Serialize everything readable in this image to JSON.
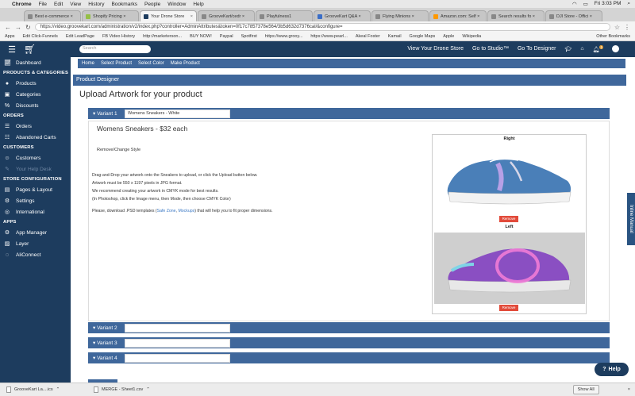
{
  "mac_menu": {
    "apple": "",
    "items": [
      "Chrome",
      "File",
      "Edit",
      "View",
      "History",
      "Bookmarks",
      "People",
      "Window",
      "Help"
    ],
    "clock": "Fri 3:03 PM"
  },
  "browser": {
    "tabs": [
      {
        "label": "Best e-commerce ×"
      },
      {
        "label": "Shopify Pricing ×"
      },
      {
        "label": "Your Drone Store"
      },
      {
        "label": "GrooveKart/cedr ×"
      },
      {
        "label": "Playfulness1"
      },
      {
        "label": "GrooveKart Q&A ×"
      },
      {
        "label": "Flying Minions ×"
      },
      {
        "label": "Amazon.com: Self ×"
      },
      {
        "label": "Search results fo ×"
      },
      {
        "label": "DJI Store - Offici ×"
      }
    ],
    "url": "https://video.groovekart.com/administration/v2/index.php?controller=AdminAttributes&token=0f17c7857378e564/3b5d632d7376cal/&configure=",
    "bookmarks": [
      "Apps",
      "Edit Click-Funnels",
      "Edit LeadPage",
      "FB Video History",
      "http://marketerson...",
      "BUY NOW!",
      "Paypal",
      "Spotfirst",
      "https://www.grooy...",
      "https://www.pearl...",
      "Akeal Foster",
      "Kamail",
      "Google Maps",
      "Apple",
      "Wikipedia",
      "Other Bookmarks"
    ]
  },
  "topnav": {
    "search_placeholder": "Search",
    "links": [
      "View Your Drone Store",
      "Go to Studio™",
      "Go To Designer"
    ],
    "notification_count": "1"
  },
  "sidebar": {
    "dashboard": "Dashboard",
    "sections": [
      {
        "heading": "PRODUCTS & CATEGORIES",
        "items": [
          {
            "label": "Products",
            "icon": "●"
          },
          {
            "label": "Categories",
            "icon": "▣"
          },
          {
            "label": "Discounts",
            "icon": "%"
          }
        ]
      },
      {
        "heading": "ORDERS",
        "items": [
          {
            "label": "Orders",
            "icon": "☰"
          },
          {
            "label": "Abandoned Carts",
            "icon": "☷"
          }
        ]
      },
      {
        "heading": "CUSTOMERS",
        "items": [
          {
            "label": "Customers",
            "icon": "☺"
          },
          {
            "label": "Your Help Desk",
            "icon": "✎"
          }
        ]
      },
      {
        "heading": "STORE CONFIGURATION",
        "items": [
          {
            "label": "Pages & Layout",
            "icon": "▤"
          },
          {
            "label": "Settings",
            "icon": "⚙"
          },
          {
            "label": "International",
            "icon": "◎"
          }
        ]
      },
      {
        "heading": "APPS",
        "items": [
          {
            "label": "App Manager",
            "icon": "⚙"
          },
          {
            "label": "Layer",
            "icon": "▨"
          },
          {
            "label": "AliConnect",
            "icon": "◌"
          }
        ]
      }
    ]
  },
  "breadcrumb": [
    "Home",
    "Select Product",
    "Select Color",
    "Make Product"
  ],
  "product_designer_label": "Product Designer",
  "page_title": "Upload Artwork for your product",
  "variants": [
    {
      "label": "▾ Variant 1",
      "value": "Womens Sneakers - White"
    },
    {
      "label": "▾ Variant 2",
      "value": ""
    },
    {
      "label": "▾ Variant 3",
      "value": ""
    },
    {
      "label": "▾ Variant 4",
      "value": ""
    }
  ],
  "variant1": {
    "product_name": "Womens Sneakers - $32 each",
    "remove_style": "Remove/Change Style",
    "instructions": [
      "Drag-and-Drop your artwork onto the Sneakers to upload, or click the Upload button below.",
      "Artwork must be 550 x 1197 pixels in JPG format.",
      "We recommend creating your artwork in CMYK mode for best results.",
      "(In Photoshop, click the Image menu, then Mode, then choose CMYK Color)"
    ],
    "psd_prefix": "Please, download .PSD templates (",
    "psd_link1": "Safe Zone",
    "psd_sep": ", ",
    "psd_link2": "Mockups",
    "psd_suffix": ") that will help you to fit proper dimensions.",
    "views": [
      {
        "label": "Right",
        "remove": "Remove"
      },
      {
        "label": "Left",
        "remove": "Remove"
      }
    ]
  },
  "inline_manual": "Inline Manual",
  "help": "Help",
  "downloads": [
    {
      "name": "GrooveKart La....ics"
    },
    {
      "name": "MERGE - Sheet1.csv"
    }
  ],
  "show_all": "Show All",
  "colors": {
    "navy": "#1d3c5e",
    "accent": "#3f679b",
    "remove": "#e24b3b"
  }
}
